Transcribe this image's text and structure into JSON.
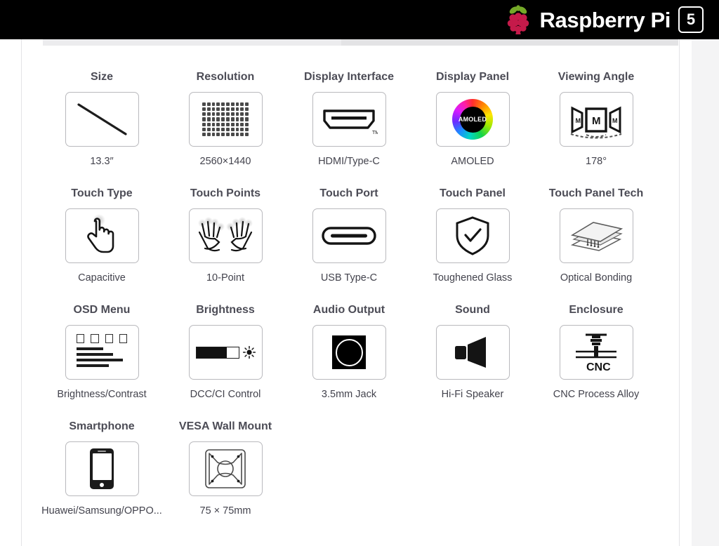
{
  "header": {
    "brand_name": "Raspberry Pi",
    "model_badge": "5",
    "logo_icon": "raspberry-pi-logo"
  },
  "specs": [
    {
      "title": "Size",
      "value": "13.3″",
      "icon": "diagonal-screen-icon"
    },
    {
      "title": "Resolution",
      "value": "2560×1440",
      "icon": "pixel-grid-icon"
    },
    {
      "title": "Display Interface",
      "value": "HDMI/Type-C",
      "icon": "hdmi-port-icon"
    },
    {
      "title": "Display Panel",
      "value": "AMOLED",
      "icon": "color-wheel-icon",
      "icon_label": "AMOLED"
    },
    {
      "title": "Viewing Angle",
      "value": "178°",
      "icon": "viewing-angle-icon",
      "icon_label": "M"
    },
    {
      "title": "Touch Type",
      "value": "Capacitive",
      "icon": "pointing-hand-icon"
    },
    {
      "title": "Touch Points",
      "value": "10-Point",
      "icon": "two-hands-icon"
    },
    {
      "title": "Touch Port",
      "value": "USB Type-C",
      "icon": "usb-c-port-icon"
    },
    {
      "title": "Touch Panel",
      "value": "Toughened Glass",
      "icon": "shield-check-icon"
    },
    {
      "title": "Touch Panel Tech",
      "value": "Optical Bonding",
      "icon": "layered-panels-icon"
    },
    {
      "title": "OSD Menu",
      "value": "Brightness/Contrast",
      "icon": "osd-menu-icon"
    },
    {
      "title": "Brightness",
      "value": "DCC/CI Control",
      "icon": "brightness-slider-icon"
    },
    {
      "title": "Audio Output",
      "value": "3.5mm Jack",
      "icon": "audio-jack-icon"
    },
    {
      "title": "Sound",
      "value": "Hi-Fi Speaker",
      "icon": "speaker-icon"
    },
    {
      "title": "Enclosure",
      "value": "CNC Process Alloy",
      "icon": "cnc-mill-icon",
      "icon_label": "CNC"
    },
    {
      "title": "Smartphone",
      "value": "Huawei/Samsung/OPPO...",
      "icon": "smartphone-icon"
    },
    {
      "title": "VESA Wall Mount",
      "value": "75 × 75mm",
      "icon": "vesa-plate-icon"
    }
  ],
  "colors": {
    "topbar_background": "#000000",
    "brand_text": "#ffffff",
    "raspberry_body": "#c51a4a",
    "raspberry_leaf": "#75a928",
    "spec_title": "#4c4c56",
    "spec_value": "#43434d",
    "box_border": "#b9b9bd",
    "page_background": "#ffffff",
    "gutter": "#f4f4f5"
  }
}
